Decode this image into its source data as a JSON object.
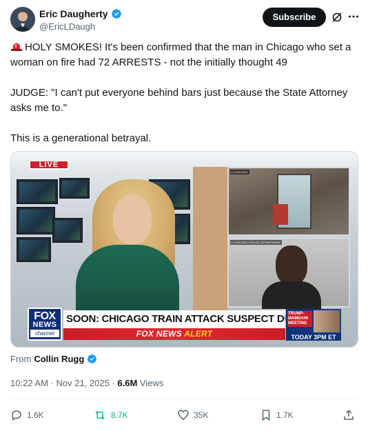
{
  "author": {
    "display_name": "Eric Daugherty",
    "handle": "@EricLDaugh",
    "verified": true,
    "avatar_icon": "user-avatar"
  },
  "header": {
    "subscribe_label": "Subscribe",
    "grok_icon": "grok-icon",
    "more_icon": "more-icon"
  },
  "tweet": {
    "emoji": "🚨",
    "line1": "HOLY SMOKES! It's been confirmed that the man in Chicago who set a woman on fire had 72 ARRESTS - not the initially thought 49",
    "line2": "JUDGE: \"I can't put everyone behind bars just because the State Attorney asks me to.\"",
    "line3": "This is a generational betrayal."
  },
  "media": {
    "live_badge": "LIVE",
    "inset1_caption": "▸ CHICAGO",
    "inset2_caption": "▸ CHICAGO POLICE DEPARTMENT",
    "network_logo_line1": "FOX",
    "network_logo_line2": "NEWS",
    "network_logo_line3": "channel",
    "headline": "SOON: CHICAGO TRAIN ATTACK SUSPECT DUE IN COURT",
    "alert_brand": "FOX NEWS ",
    "alert_word": "ALERT",
    "promo_title": "TRUMP-MAMDANI MEETING",
    "promo_time": "TODAY 3PM ET"
  },
  "source": {
    "from_label": "From",
    "from_name": "Collin Rugg",
    "verified": true
  },
  "meta": {
    "time": "10:22 AM",
    "separator": " · ",
    "date": "Nov 21, 2025",
    "views_count": "6.6M",
    "views_label": " Views"
  },
  "actions": {
    "replies": "1.6K",
    "reposts": "8.7K",
    "likes": "35K",
    "bookmarks": "1.7K"
  },
  "colors": {
    "verified_blue": "#1d9bf0",
    "repost_green": "#00ba7c",
    "text_primary": "#0f1419",
    "text_secondary": "#536471"
  }
}
